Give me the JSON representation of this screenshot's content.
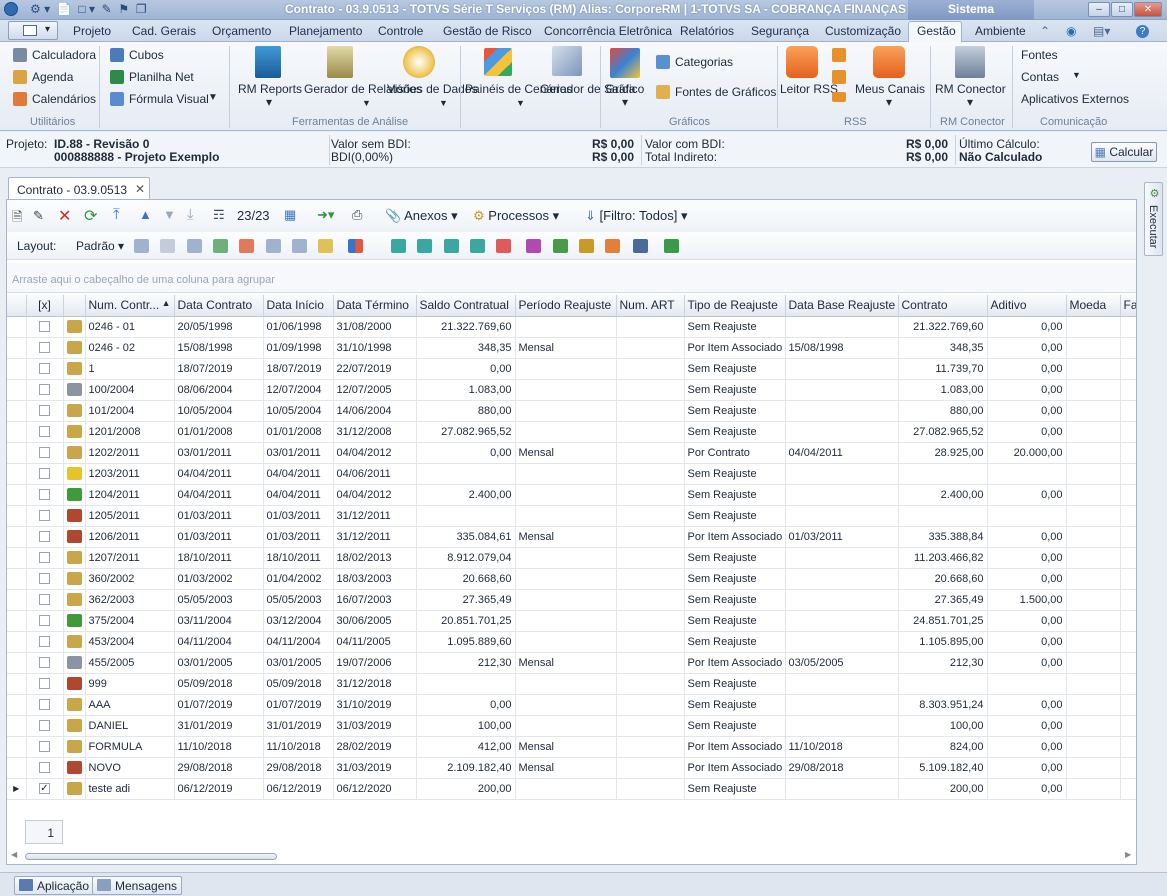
{
  "window": {
    "title": "Contrato - 03.9.0513 - TOTVS Série T Serviços (RM) Alias: CorporeRM | 1-TOTVS SA - COBRANÇA FINANÇAS",
    "system_tab": "Sistema"
  },
  "menu": {
    "items": [
      "Projeto",
      "Cad. Gerais",
      "Orçamento",
      "Planejamento",
      "Controle",
      "Gestão de Risco",
      "Concorrência Eletrônica",
      "Relatórios",
      "Segurança",
      "Customização",
      "Gestão",
      "Ambiente"
    ],
    "active": "Gestão"
  },
  "ribbon": {
    "util": {
      "items": [
        "Calculadora",
        "Agenda",
        "Calendários"
      ],
      "label": "Utilitários"
    },
    "fa": {
      "cubos": "Cubos",
      "planilha": "Planilha Net",
      "formula": "Fórmula Visual",
      "rm_reports": "RM Reports",
      "gerador_rel": "Gerador de Relatórios",
      "visoes": "Visões de Dados",
      "paineis": "Painéis de Cenários",
      "gerador_saida": "Gerador de Saída",
      "label": "Ferramentas de Análise"
    },
    "graf": {
      "grafico": "Gráfico",
      "categorias": "Categorias",
      "fontes_graf": "Fontes de Gráficos",
      "label": "Gráficos"
    },
    "rss": {
      "leitor": "Leitor RSS",
      "meus_canais": "Meus Canais",
      "label": "RSS"
    },
    "rmc": {
      "conector": "RM Conector",
      "label": "RM Conector"
    },
    "com": {
      "fontes": "Fontes",
      "contas": "Contas",
      "apps": "Aplicativos Externos",
      "label": "Comunicação"
    }
  },
  "info": {
    "projeto_lbl": "Projeto:",
    "projeto_id": "ID.88 - Revisão 0",
    "projeto_nome": "000888888 - Projeto Exemplo",
    "vsb_lbl": "Valor sem BDI:",
    "vsb_val": "R$ 0,00",
    "bdi_lbl": "BDI(0,00%)",
    "bdi_val": "R$ 0,00",
    "vcb_lbl": "Valor com BDI:",
    "vcb_val": "R$ 0,00",
    "ti_lbl": "Total Indireto:",
    "ti_val": "R$ 0,00",
    "uc_lbl": "Último Cálculo:",
    "uc_val": "Não Calculado",
    "calc_btn": "Calcular"
  },
  "doc_tab": "Contrato - 03.9.0513",
  "toolbar": {
    "counter": "23/23",
    "anexos": "Anexos",
    "processos": "Processos",
    "filtro": "[Filtro: Todos]",
    "layout": "Layout:",
    "padrao": "Padrão"
  },
  "group_hint": "Arraste aqui o cabeçalho de uma coluna para agrupar",
  "columns": [
    "[x]",
    "Num. Contr...",
    "Data Contrato",
    "Data Início",
    "Data Término",
    "Saldo Contratual",
    "Período Reajuste",
    "Num. ART",
    "Tipo de Reajuste",
    "Data Base Reajuste",
    "Contrato",
    "Aditivo",
    "Moeda",
    "Fa"
  ],
  "rows": [
    {
      "chk": false,
      "icon": "#c9a64a",
      "num": "0246 - 01",
      "dc": "20/05/1998",
      "di": "01/06/1998",
      "dt": "31/08/2000",
      "saldo": "21.322.769,60",
      "per": "",
      "art": "",
      "tipo": "Sem Reajuste",
      "dbr": "",
      "contrato": "21.322.769,60",
      "aditivo": "0,00"
    },
    {
      "chk": false,
      "icon": "#c9a64a",
      "num": "0246 - 02",
      "dc": "15/08/1998",
      "di": "01/09/1998",
      "dt": "31/10/1998",
      "saldo": "348,35",
      "per": "Mensal",
      "art": "",
      "tipo": "Por Item Associado",
      "dbr": "15/08/1998",
      "contrato": "348,35",
      "aditivo": "0,00"
    },
    {
      "chk": false,
      "icon": "#c9a64a",
      "num": "1",
      "dc": "18/07/2019",
      "di": "18/07/2019",
      "dt": "22/07/2019",
      "saldo": "0,00",
      "per": "",
      "art": "",
      "tipo": "Sem Reajuste",
      "dbr": "",
      "contrato": "11.739,70",
      "aditivo": "0,00"
    },
    {
      "chk": false,
      "icon": "#8a94a3",
      "num": "100/2004",
      "dc": "08/06/2004",
      "di": "12/07/2004",
      "dt": "12/07/2005",
      "saldo": "1.083,00",
      "per": "",
      "art": "",
      "tipo": "Sem Reajuste",
      "dbr": "",
      "contrato": "1.083,00",
      "aditivo": "0,00"
    },
    {
      "chk": false,
      "icon": "#c9a64a",
      "num": "101/2004",
      "dc": "10/05/2004",
      "di": "10/05/2004",
      "dt": "14/06/2004",
      "saldo": "880,00",
      "per": "",
      "art": "",
      "tipo": "Sem Reajuste",
      "dbr": "",
      "contrato": "880,00",
      "aditivo": "0,00"
    },
    {
      "chk": false,
      "icon": "#c9a64a",
      "num": "1201/2008",
      "dc": "01/01/2008",
      "di": "01/01/2008",
      "dt": "31/12/2008",
      "saldo": "27.082.965,52",
      "per": "",
      "art": "",
      "tipo": "Sem Reajuste",
      "dbr": "",
      "contrato": "27.082.965,52",
      "aditivo": "0,00"
    },
    {
      "chk": false,
      "icon": "#c9a64a",
      "num": "1202/2011",
      "dc": "03/01/2011",
      "di": "03/01/2011",
      "dt": "04/04/2012",
      "saldo": "0,00",
      "per": "Mensal",
      "art": "",
      "tipo": "Por Contrato",
      "dbr": "04/04/2011",
      "contrato": "28.925,00",
      "aditivo": "20.000,00"
    },
    {
      "chk": false,
      "icon": "#e3c52a",
      "num": "1203/2011",
      "dc": "04/04/2011",
      "di": "04/04/2011",
      "dt": "04/06/2011",
      "saldo": "",
      "per": "",
      "art": "",
      "tipo": "Sem Reajuste",
      "dbr": "",
      "contrato": "",
      "aditivo": ""
    },
    {
      "chk": false,
      "icon": "#3f9a3a",
      "num": "1204/2011",
      "dc": "04/04/2011",
      "di": "04/04/2011",
      "dt": "04/04/2012",
      "saldo": "2.400,00",
      "per": "",
      "art": "",
      "tipo": "Sem Reajuste",
      "dbr": "",
      "contrato": "2.400,00",
      "aditivo": "0,00"
    },
    {
      "chk": false,
      "icon": "#b0482f",
      "num": "1205/2011",
      "dc": "01/03/2011",
      "di": "01/03/2011",
      "dt": "31/12/2011",
      "saldo": "",
      "per": "",
      "art": "",
      "tipo": "Sem Reajuste",
      "dbr": "",
      "contrato": "",
      "aditivo": ""
    },
    {
      "chk": false,
      "icon": "#b0482f",
      "num": "1206/2011",
      "dc": "01/03/2011",
      "di": "01/03/2011",
      "dt": "31/12/2011",
      "saldo": "335.084,61",
      "per": "Mensal",
      "art": "",
      "tipo": "Por Item Associado",
      "dbr": "01/03/2011",
      "contrato": "335.388,84",
      "aditivo": "0,00"
    },
    {
      "chk": false,
      "icon": "#c9a64a",
      "num": "1207/2011",
      "dc": "18/10/2011",
      "di": "18/10/2011",
      "dt": "18/02/2013",
      "saldo": "8.912.079,04",
      "per": "",
      "art": "",
      "tipo": "Sem Reajuste",
      "dbr": "",
      "contrato": "11.203.466,82",
      "aditivo": "0,00"
    },
    {
      "chk": false,
      "icon": "#c9a64a",
      "num": "360/2002",
      "dc": "01/03/2002",
      "di": "01/04/2002",
      "dt": "18/03/2003",
      "saldo": "20.668,60",
      "per": "",
      "art": "",
      "tipo": "Sem Reajuste",
      "dbr": "",
      "contrato": "20.668,60",
      "aditivo": "0,00"
    },
    {
      "chk": false,
      "icon": "#c9a64a",
      "num": "362/2003",
      "dc": "05/05/2003",
      "di": "05/05/2003",
      "dt": "16/07/2003",
      "saldo": "27.365,49",
      "per": "",
      "art": "",
      "tipo": "Sem Reajuste",
      "dbr": "",
      "contrato": "27.365,49",
      "aditivo": "1.500,00"
    },
    {
      "chk": false,
      "icon": "#3f9a3a",
      "num": "375/2004",
      "dc": "03/11/2004",
      "di": "03/12/2004",
      "dt": "30/06/2005",
      "saldo": "20.851.701,25",
      "per": "",
      "art": "",
      "tipo": "Sem Reajuste",
      "dbr": "",
      "contrato": "24.851.701,25",
      "aditivo": "0,00"
    },
    {
      "chk": false,
      "icon": "#c9a64a",
      "num": "453/2004",
      "dc": "04/11/2004",
      "di": "04/11/2004",
      "dt": "04/11/2005",
      "saldo": "1.095.889,60",
      "per": "",
      "art": "",
      "tipo": "Sem Reajuste",
      "dbr": "",
      "contrato": "1.105.895,00",
      "aditivo": "0,00"
    },
    {
      "chk": false,
      "icon": "#8a94a3",
      "num": "455/2005",
      "dc": "03/01/2005",
      "di": "03/01/2005",
      "dt": "19/07/2006",
      "saldo": "212,30",
      "per": "Mensal",
      "art": "",
      "tipo": "Por Item Associado",
      "dbr": "03/05/2005",
      "contrato": "212,30",
      "aditivo": "0,00"
    },
    {
      "chk": false,
      "icon": "#b0482f",
      "num": "999",
      "dc": "05/09/2018",
      "di": "05/09/2018",
      "dt": "31/12/2018",
      "saldo": "",
      "per": "",
      "art": "",
      "tipo": "Sem Reajuste",
      "dbr": "",
      "contrato": "",
      "aditivo": ""
    },
    {
      "chk": false,
      "icon": "#c9a64a",
      "num": "AAA",
      "dc": "01/07/2019",
      "di": "01/07/2019",
      "dt": "31/10/2019",
      "saldo": "0,00",
      "per": "",
      "art": "",
      "tipo": "Sem Reajuste",
      "dbr": "",
      "contrato": "8.303.951,24",
      "aditivo": "0,00"
    },
    {
      "chk": false,
      "icon": "#c9a64a",
      "num": "DANIEL",
      "dc": "31/01/2019",
      "di": "31/01/2019",
      "dt": "31/03/2019",
      "saldo": "100,00",
      "per": "",
      "art": "",
      "tipo": "Sem Reajuste",
      "dbr": "",
      "contrato": "100,00",
      "aditivo": "0,00"
    },
    {
      "chk": false,
      "icon": "#c9a64a",
      "num": "FORMULA",
      "dc": "11/10/2018",
      "di": "11/10/2018",
      "dt": "28/02/2019",
      "saldo": "412,00",
      "per": "Mensal",
      "art": "",
      "tipo": "Por Item Associado",
      "dbr": "11/10/2018",
      "contrato": "824,00",
      "aditivo": "0,00"
    },
    {
      "chk": false,
      "icon": "#b0482f",
      "num": "NOVO",
      "dc": "29/08/2018",
      "di": "29/08/2018",
      "dt": "31/03/2019",
      "saldo": "2.109.182,40",
      "per": "Mensal",
      "art": "",
      "tipo": "Por Item Associado",
      "dbr": "29/08/2018",
      "contrato": "5.109.182,40",
      "aditivo": "0,00"
    },
    {
      "chk": true,
      "icon": "#c9a64a",
      "num": "teste adi",
      "dc": "06/12/2019",
      "di": "06/12/2019",
      "dt": "06/12/2020",
      "saldo": "200,00",
      "per": "",
      "art": "",
      "tipo": "Sem Reajuste",
      "dbr": "",
      "contrato": "200,00",
      "aditivo": "0,00",
      "current": true
    }
  ],
  "pager": "1",
  "side_panel": "Executar",
  "status": {
    "aplicacao": "Aplicação",
    "mensagens": "Mensagens"
  }
}
